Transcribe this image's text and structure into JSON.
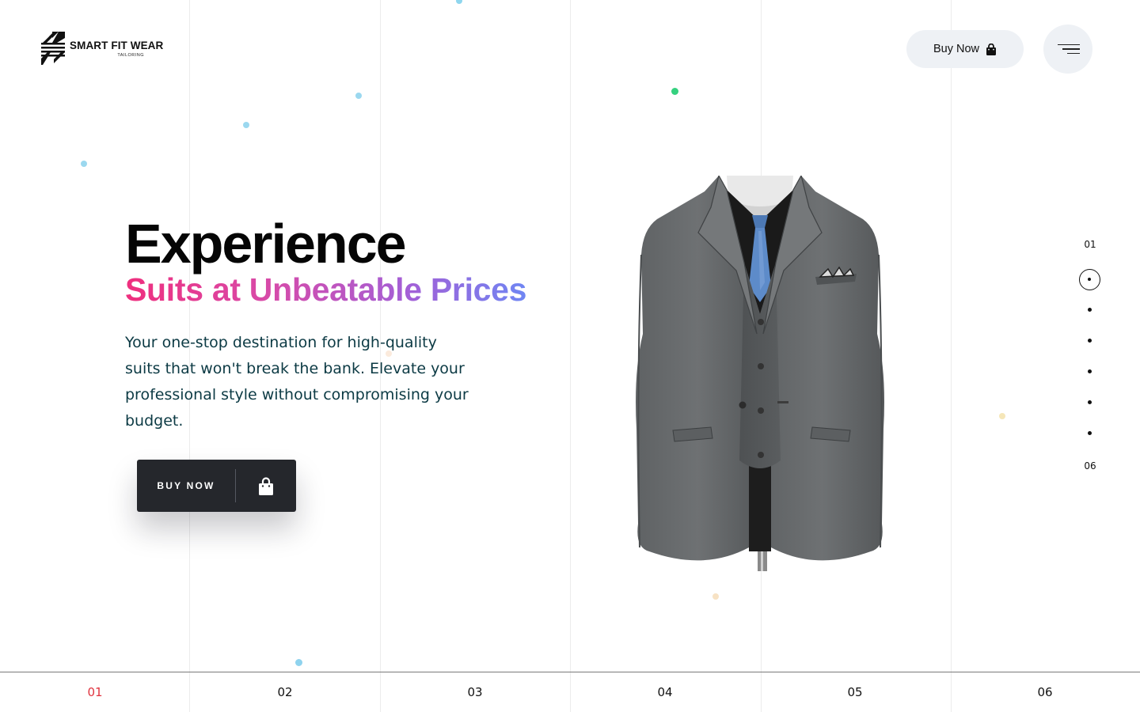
{
  "brand": {
    "name": "SMART FIT WEAR",
    "tagline": "TAILORING"
  },
  "header": {
    "buy_now_label": "Buy Now",
    "buy_icon": "shopping-bag-icon",
    "menu_icon": "hamburger-menu-icon"
  },
  "hero": {
    "title": "Experience",
    "subtitle": "Suits at Unbeatable Prices",
    "description": "Your one-stop destination for high-quality suits that won't break the bank. Elevate your professional style without compromising your budget.",
    "cta_label": "BUY NOW",
    "cta_icon": "shopping-bag-icon",
    "gradient_colors": [
      "#ef2f7e",
      "#d84aa8",
      "#a45fd6",
      "#6f86f3"
    ]
  },
  "product_image": {
    "subject": "grey three-piece suit with blue tie on mannequin"
  },
  "side_nav": {
    "first": "01",
    "last": "06",
    "active_index": 1,
    "total": 6
  },
  "bottom_nav": {
    "items": [
      "01",
      "02",
      "03",
      "04",
      "05",
      "06"
    ],
    "active_index": 0,
    "active_color": "#e0343f"
  },
  "colors": {
    "cta_bg": "#25272c",
    "pill_bg": "#eef1f5",
    "text_dark": "#0c3a44"
  }
}
